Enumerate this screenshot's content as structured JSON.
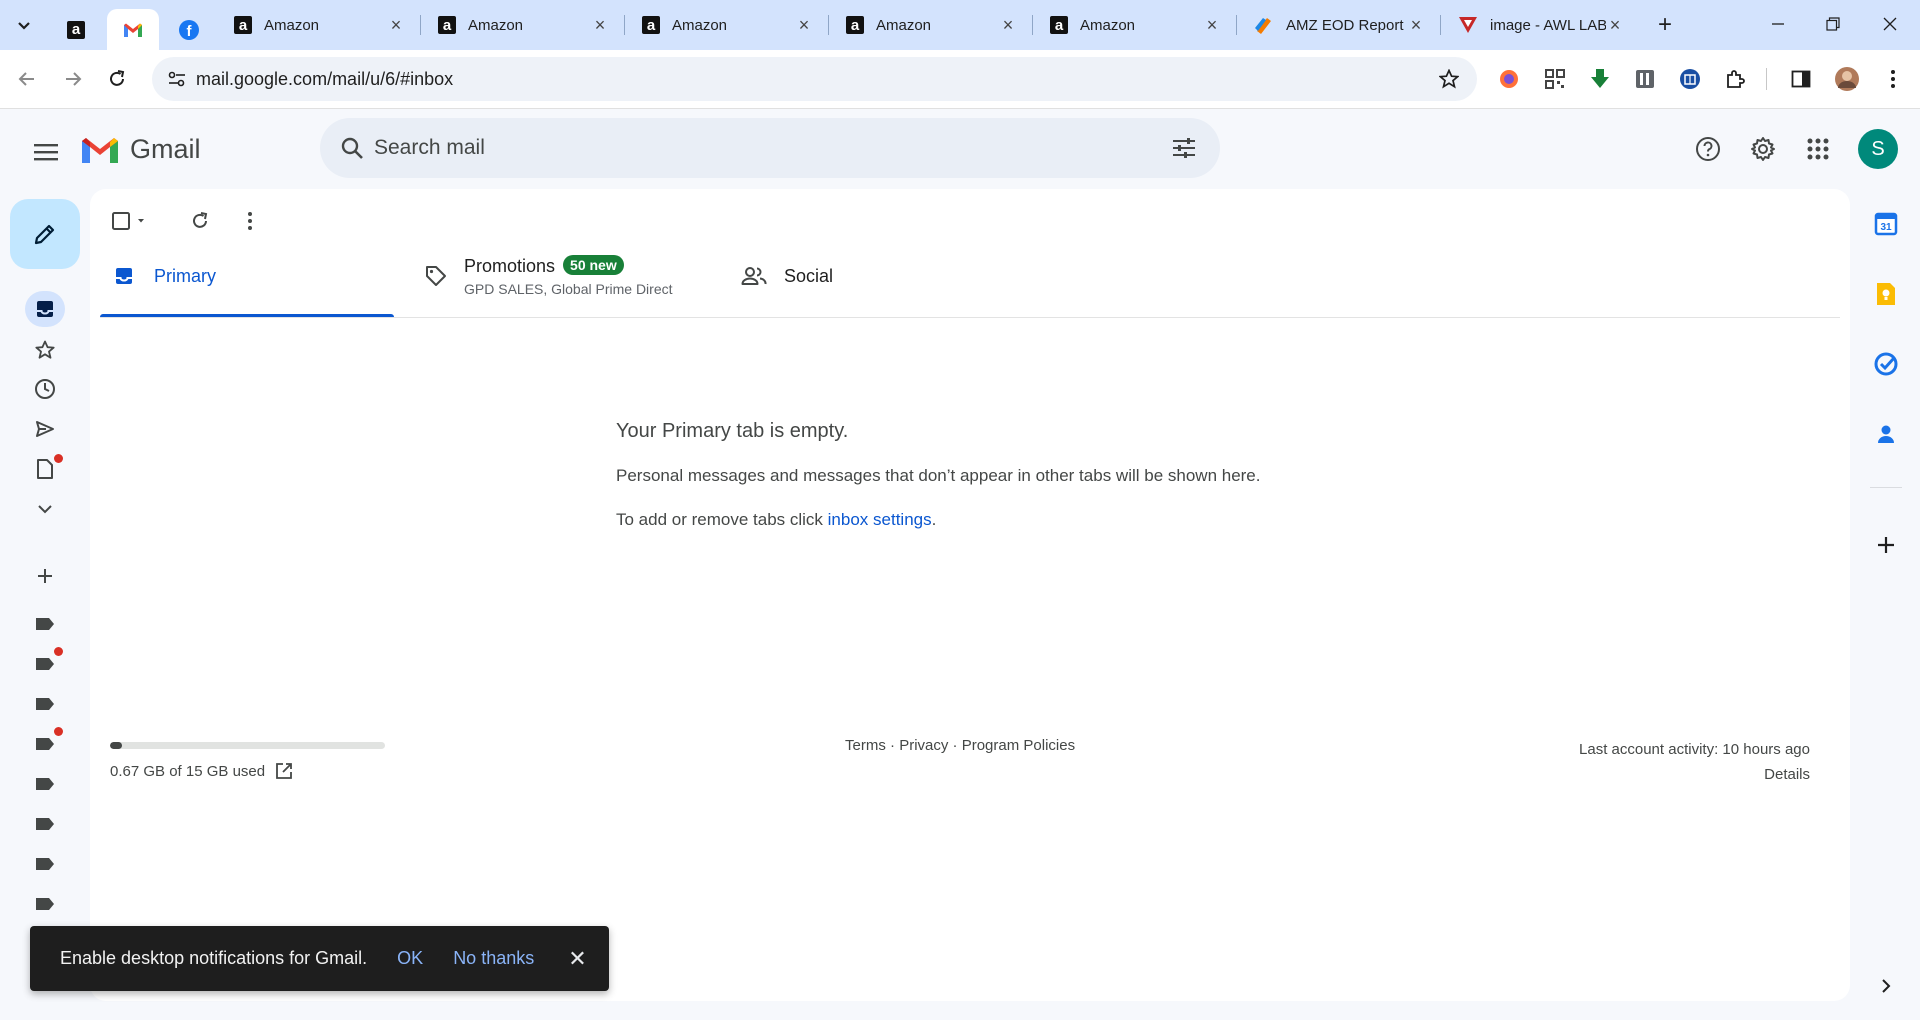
{
  "browser": {
    "tabs": [
      {
        "title": "",
        "favicon": "amazon-icon",
        "pinned": true
      },
      {
        "title": "",
        "favicon": "gmail-icon",
        "pinned": true,
        "active": true
      },
      {
        "title": "",
        "favicon": "facebook-icon",
        "pinned": true
      },
      {
        "title": "Amazon",
        "favicon": "amazon-icon"
      },
      {
        "title": "Amazon",
        "favicon": "amazon-icon"
      },
      {
        "title": "Amazon",
        "favicon": "amazon-icon"
      },
      {
        "title": "Amazon",
        "favicon": "amazon-icon"
      },
      {
        "title": "Amazon",
        "favicon": "amazon-icon"
      },
      {
        "title": "AMZ EOD Report",
        "favicon": "sheets-pencil-icon"
      },
      {
        "title": "image - AWL LAB",
        "favicon": "awl-icon"
      }
    ],
    "url": "mail.google.com/mail/u/6/#inbox",
    "colors": {
      "tabstrip": "#d3e3fd",
      "accent": "#0b57d0"
    }
  },
  "gmail": {
    "logo_text": "Gmail",
    "search_placeholder": "Search mail",
    "avatar_letter": "S",
    "category_tabs": {
      "primary": "Primary",
      "promotions": "Promotions",
      "promotions_badge": "50 new",
      "promotions_senders": "GPD SALES, Global Prime Direct",
      "social": "Social"
    },
    "empty": {
      "title": "Your Primary tab is empty.",
      "message": "Personal messages and messages that don’t appear in other tabs will be shown here.",
      "settings_prefix": "To add or remove tabs click ",
      "settings_link": "inbox settings",
      "settings_suffix": "."
    },
    "storage": {
      "text": "0.67 GB of 15 GB used",
      "fraction_used": 0.045
    },
    "footer": {
      "terms": "Terms",
      "privacy": "Privacy",
      "policies": "Program Policies",
      "separator": " · "
    },
    "activity": {
      "text": "Last account activity: 10 hours ago",
      "details": "Details"
    },
    "side_apps": [
      "calendar-icon",
      "keep-icon",
      "tasks-icon",
      "contacts-icon",
      "add-icon"
    ],
    "calendar_day": "31"
  },
  "snackbar": {
    "message": "Enable desktop notifications for Gmail.",
    "ok": "OK",
    "no_thanks": "No thanks"
  }
}
